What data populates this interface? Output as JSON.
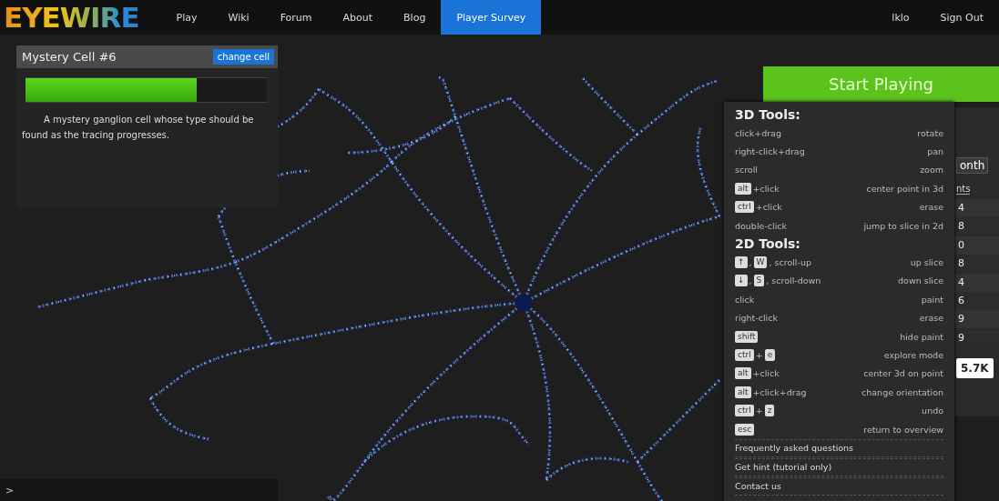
{
  "nav": {
    "logo": "EYEWIRE",
    "items": [
      {
        "label": "Play",
        "selected": false
      },
      {
        "label": "Wiki",
        "selected": false
      },
      {
        "label": "Forum",
        "selected": false
      },
      {
        "label": "About",
        "selected": false
      },
      {
        "label": "Blog",
        "selected": false
      },
      {
        "label": "Player Survey",
        "selected": true
      }
    ],
    "user": "lklo",
    "sign_out": "Sign Out"
  },
  "cell_panel": {
    "title": "Mystery Cell #6",
    "change_button": "change cell",
    "progress": {
      "level": 0.71
    },
    "description": "A mystery ganglion cell whose type should be found as the tracing progresses."
  },
  "start_button": "Start Playing",
  "leaderboard": {
    "tab": "onth",
    "header": "nts",
    "scores": [
      "4",
      "8",
      "0",
      "8",
      "4",
      "6",
      "9",
      "9"
    ],
    "badge": "5.7K"
  },
  "help": {
    "sections": [
      {
        "title": "3D Tools:",
        "rows": [
          {
            "parts": [
              {
                "kind": "text",
                "text": "click+drag"
              }
            ],
            "action": "rotate"
          },
          {
            "parts": [
              {
                "kind": "text",
                "text": "right-click+drag"
              }
            ],
            "action": "pan"
          },
          {
            "parts": [
              {
                "kind": "text",
                "text": "scroll"
              }
            ],
            "action": "zoom"
          },
          {
            "parts": [
              {
                "kind": "key",
                "text": "alt"
              },
              {
                "kind": "text",
                "text": "+click"
              }
            ],
            "action": "center point in 3d"
          },
          {
            "parts": [
              {
                "kind": "key",
                "text": "ctrl"
              },
              {
                "kind": "text",
                "text": "+click"
              }
            ],
            "action": "erase"
          },
          {
            "parts": [
              {
                "kind": "text",
                "text": "double-click"
              }
            ],
            "action": "jump to slice in 2d"
          }
        ]
      },
      {
        "title": "2D Tools:",
        "rows": [
          {
            "parts": [
              {
                "kind": "key",
                "text": "↑"
              },
              {
                "kind": "text",
                "text": ","
              },
              {
                "kind": "key",
                "text": "W"
              },
              {
                "kind": "text",
                "text": ", scroll-up"
              }
            ],
            "action": "up slice"
          },
          {
            "parts": [
              {
                "kind": "key",
                "text": "↓"
              },
              {
                "kind": "text",
                "text": ","
              },
              {
                "kind": "key",
                "text": "S"
              },
              {
                "kind": "text",
                "text": ", scroll-down"
              }
            ],
            "action": "down slice"
          },
          {
            "parts": [
              {
                "kind": "text",
                "text": "click"
              }
            ],
            "action": "paint"
          },
          {
            "parts": [
              {
                "kind": "text",
                "text": "right-click"
              }
            ],
            "action": "erase"
          },
          {
            "parts": [
              {
                "kind": "key",
                "text": "shift"
              }
            ],
            "action": "hide paint"
          },
          {
            "parts": [
              {
                "kind": "key",
                "text": "ctrl"
              },
              {
                "kind": "text",
                "text": "+"
              },
              {
                "kind": "key",
                "text": "e"
              }
            ],
            "action": "explore mode"
          },
          {
            "parts": [
              {
                "kind": "key",
                "text": "alt"
              },
              {
                "kind": "text",
                "text": "+click"
              }
            ],
            "action": "center 3d on point"
          },
          {
            "parts": [
              {
                "kind": "key",
                "text": "alt"
              },
              {
                "kind": "text",
                "text": "+click+drag"
              }
            ],
            "action": "change orientation"
          },
          {
            "parts": [
              {
                "kind": "key",
                "text": "ctrl"
              },
              {
                "kind": "text",
                "text": "+"
              },
              {
                "kind": "key",
                "text": "z"
              }
            ],
            "action": "undo"
          },
          {
            "parts": [
              {
                "kind": "key",
                "text": "esc"
              }
            ],
            "action": "return to overview"
          }
        ]
      }
    ],
    "links": [
      "Frequently asked questions",
      "Get hint (tutorial only)",
      "Contact us"
    ]
  },
  "chat": {
    "prompt": ">"
  }
}
